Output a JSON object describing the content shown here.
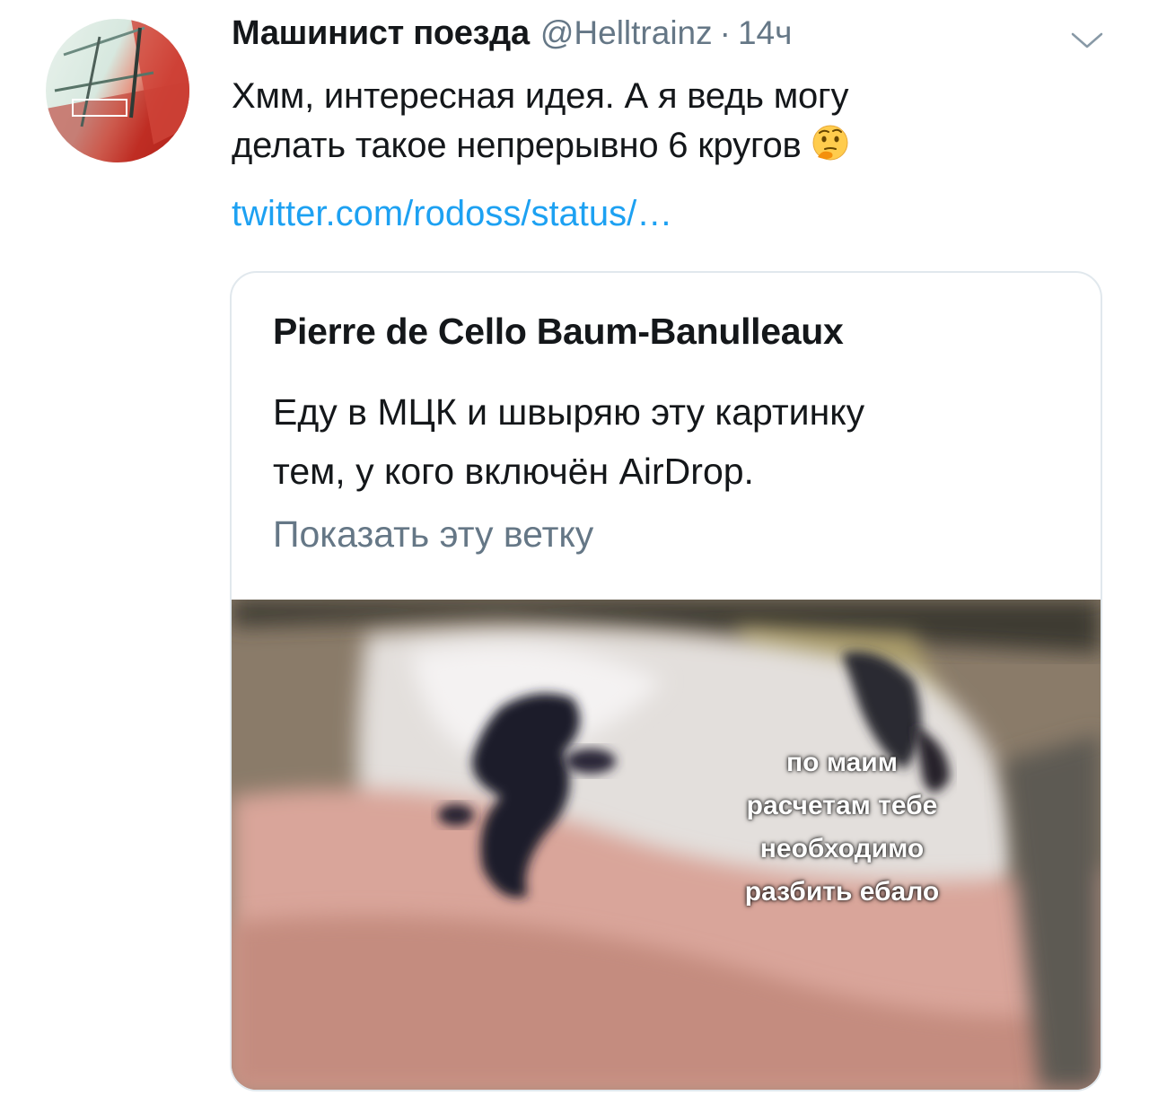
{
  "tweet": {
    "author_name": "Машинист поезда",
    "author_handle": "@Helltrainz",
    "separator": "·",
    "time": "14ч",
    "text_lines": [
      "Хмм, интересная идея. А я ведь могу",
      "делать такое непрерывно 6 кругов"
    ],
    "emoji": "thinking-face-emoji",
    "link": "twitter.com/rodoss/status/…"
  },
  "quoted": {
    "author_name": "Pierre de Cello Baum-Banulleaux",
    "text_lines": [
      "Еду в МЦК и швыряю эту картинку",
      "тем, у кого включён AirDrop."
    ],
    "show_thread": "Показать эту ветку",
    "media_caption_lines": [
      "по маим",
      "расчетам тебе",
      "необходимо",
      "разбить ебало"
    ]
  },
  "colors": {
    "link": "#1da1f2",
    "secondary_text": "#657786",
    "border": "#e1e8ed"
  }
}
